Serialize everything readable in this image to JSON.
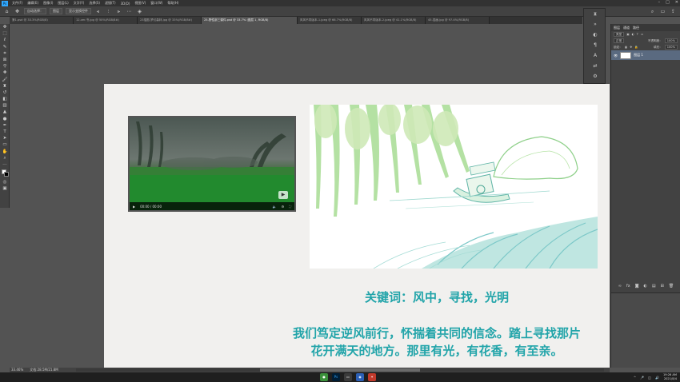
{
  "app": {
    "logo": "Ps",
    "menus": [
      "文件(F)",
      "编辑(E)",
      "图像(I)",
      "图层(L)",
      "文字(Y)",
      "选择(S)",
      "滤镜(T)",
      "3D(D)",
      "视图(V)",
      "窗口(W)",
      "帮助(H)"
    ]
  },
  "options_bar": {
    "auto_select_label": "自动选择：",
    "auto_select_value": "图层",
    "transform_label": "显示变换控件"
  },
  "tabs": [
    {
      "label": "第1.psd @ 33.3%(RGB/8)",
      "active": false
    },
    {
      "label": "12-ver-书.jpg @ 50%(RGB/8#)",
      "active": false
    },
    {
      "label": "23插图-梦幻森林.jpg @ 33%(RGB/8#)",
      "active": false
    },
    {
      "label": "25-野性部三课件.psd @ 33.7% (图层 1, RGB/8)",
      "active": true
    },
    {
      "label": "风风不同版本-1.jpeg @ 66.7%(RGB/8)",
      "active": false
    },
    {
      "label": "风风不同版本-2.jpeg @ 41.1%(RGB/8)",
      "active": false
    },
    {
      "label": "45-插画.jpg @ 97.4%(RGB/8)",
      "active": false
    }
  ],
  "canvas": {
    "keywords": "关键词：风中，寻找，光明",
    "paragraph_line1": "我们笃定逆风前行，怀揣着共同的信念。踏上寻找那片",
    "paragraph_line2": "花开满天的地方。那里有光，有花香，有至亲。",
    "video_time": "00:00 / 00:00"
  },
  "status": {
    "zoom": "33.46%",
    "doc_size": "文档:28.5M/21.8M"
  },
  "layers_panel": {
    "tabs": [
      "图层",
      "通道",
      "路径"
    ],
    "kind_label": "类型",
    "blend_mode": "正常",
    "opacity_label": "不透明度：",
    "opacity_value": "100%",
    "lock_label": "锁定：",
    "fill_label": "填充：",
    "fill_value": "100%",
    "layer_name": "图层 1"
  },
  "taskbar": {
    "time": "19:26 AM",
    "date": "2021/8/4"
  },
  "colors": {
    "accent_text": "#21a4a9",
    "ps_blue": "#31a8ff",
    "illustration_green": "#9fd68f",
    "illustration_teal": "#7cc8c8"
  }
}
